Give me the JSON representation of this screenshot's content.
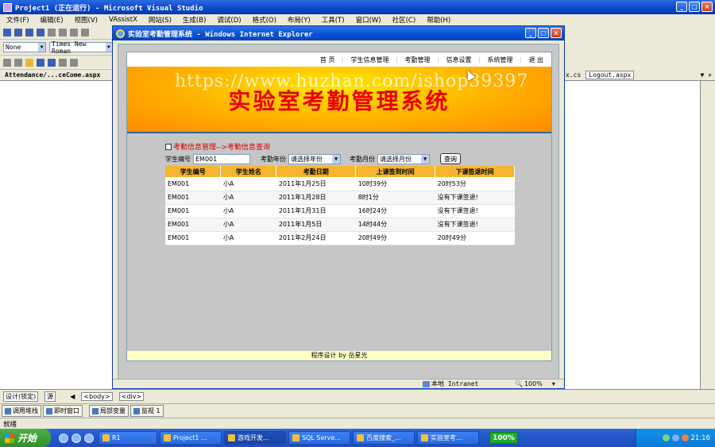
{
  "vs": {
    "title": "Project1 (正在运行) - Microsoft Visual Studio",
    "menu": [
      "文件(F)",
      "编辑(E)",
      "视图(V)",
      "VAssistX",
      "网站(S)",
      "生成(B)",
      "调试(D)",
      "格式(O)",
      "布局(Y)",
      "工具(T)",
      "窗口(W)",
      "社区(C)",
      "帮助(H)"
    ],
    "style_combo": "None",
    "font_combo": "Times New Roman",
    "doc_tab": "Attendance/...ceCome.aspx",
    "right_tabs": [
      "x.cs",
      "Logout.aspx"
    ],
    "design_tab": "设计(锁定)",
    "source_tab": "源",
    "tag_body": "<body>",
    "tag_div": "<div>",
    "bottom_tabs": [
      "调用堆栈",
      "即时窗口",
      "局部变量",
      "监视 1"
    ],
    "status": "就绪"
  },
  "ie": {
    "title": "实验室考勤管理系统 - Windows Internet Explorer",
    "status_zone": "本地 Intranet",
    "zoom": "100%"
  },
  "site": {
    "nav": [
      "首 页",
      "学生信息管理",
      "考勤管理",
      "信息设置",
      "系统管理",
      "退 出"
    ],
    "banner_title": "实验室考勤管理系统",
    "watermark": "https://www.huzhan.com/ishop39397",
    "breadcrumb": "考勤信息管理-->考勤信息查询",
    "search": {
      "id_label": "学生编号",
      "id_value": "EM001",
      "year_label": "考勤年份",
      "year_value": "请选择年份",
      "month_label": "考勤月份",
      "month_value": "请选择月份",
      "query_label": "查询"
    },
    "table": {
      "headers": [
        "学生编号",
        "学生姓名",
        "考勤日期",
        "上课签到时间",
        "下课签退时间"
      ],
      "rows": [
        [
          "EM001",
          "小A",
          "2011年1月25日",
          "10时39分",
          "20时53分"
        ],
        [
          "EM001",
          "小A",
          "2011年1月28日",
          "8时1分",
          "没有下课签退!"
        ],
        [
          "EM001",
          "小A",
          "2011年1月31日",
          "16时24分",
          "没有下课签退!"
        ],
        [
          "EM001",
          "小A",
          "2011年1月5日",
          "14时44分",
          "没有下课签退!"
        ],
        [
          "EM001",
          "小A",
          "2011年2月24日",
          "20时49分",
          "20时49分"
        ]
      ]
    },
    "footer": "程序设计 by 岳星光"
  },
  "taskbar": {
    "start": "开始",
    "tasks": [
      "R1",
      "Project1 ...",
      "游戏开发...",
      "SQL Serve...",
      "百度搜索_...",
      "实验室考..."
    ],
    "percent": "100%",
    "clock": "21:16"
  }
}
